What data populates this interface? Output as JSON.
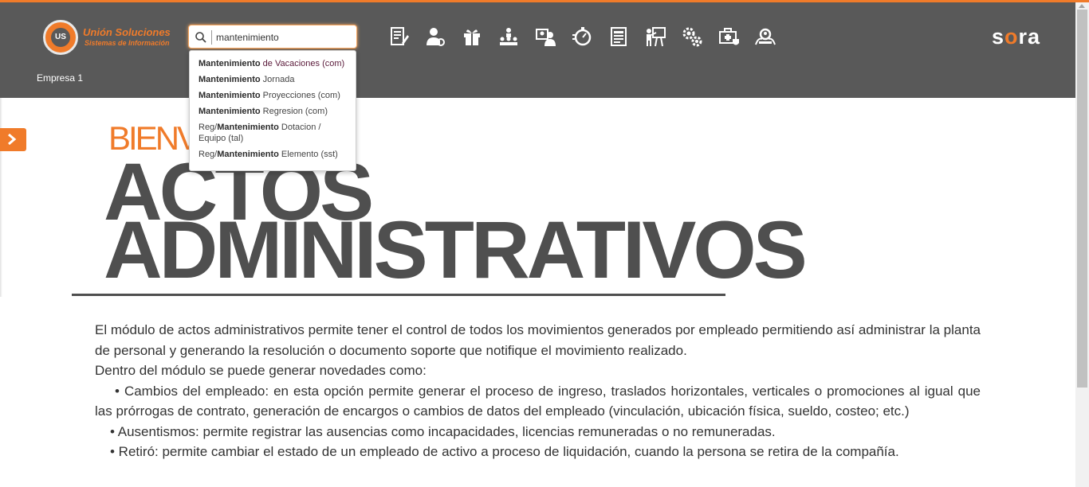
{
  "header": {
    "logo_title": "Unión Soluciones",
    "logo_subtitle": "Sistemas de Información",
    "logo_badge": "US",
    "company": "Empresa 1",
    "brand_prefix": "s",
    "brand_accent": "o",
    "brand_suffix": "ra"
  },
  "search": {
    "value": "mantenimiento",
    "placeholder": ""
  },
  "toolbar": {
    "icons": [
      "document-edit-icon",
      "user-settings-icon",
      "gift-icon",
      "org-chart-icon",
      "id-card-icon",
      "stopwatch-icon",
      "report-icon",
      "training-icon",
      "gears-icon",
      "medical-case-icon",
      "group-search-icon"
    ]
  },
  "dropdown": {
    "items": [
      {
        "pre": "",
        "bold": "Mantenimiento",
        "post": " de Vacaciones (com)"
      },
      {
        "pre": "",
        "bold": "Mantenimiento",
        "post": " Jornada"
      },
      {
        "pre": "",
        "bold": "Mantenimiento",
        "post": " Proyecciones (com)"
      },
      {
        "pre": "",
        "bold": "Mantenimiento",
        "post": " Regresion (com)"
      },
      {
        "pre": "Reg/",
        "bold": "Mantenimiento",
        "post": " Dotacion / Equipo (tal)"
      },
      {
        "pre": "Reg/",
        "bold": "Mantenimiento",
        "post": " Elemento (sst)"
      }
    ]
  },
  "main": {
    "welcome": "BIENVENIDO",
    "title_line1": "ACTOS",
    "title_line2": "ADMINISTRATIVOS",
    "paragraph1": "El módulo de actos administrativos permite tener el control de todos los movimientos generados por empleado permitiendo así administrar la planta de personal y generando la resolución o documento soporte que notifique el movimiento realizado.",
    "paragraph2": "Dentro del módulo se puede generar novedades como:",
    "bullet1": "•  Cambios del empleado: en esta opción permite generar el proceso de ingreso, traslados horizontales, verticales o promociones al igual que las prórrogas de contrato, generación de encargos o cambios de datos del empleado (vinculación, ubicación física, sueldo, costeo; etc.)",
    "bullet2": "•  Ausentismos: permite registrar las ausencias como incapacidades, licencias remuneradas o no remuneradas.",
    "bullet3": "•  Retiró: permite cambiar el estado de un empleado de activo a proceso de liquidación, cuando la persona se retira de la compañía."
  },
  "colors": {
    "accent": "#f07b2a",
    "header_bg": "#595959",
    "title_text": "#4f4f4f"
  }
}
